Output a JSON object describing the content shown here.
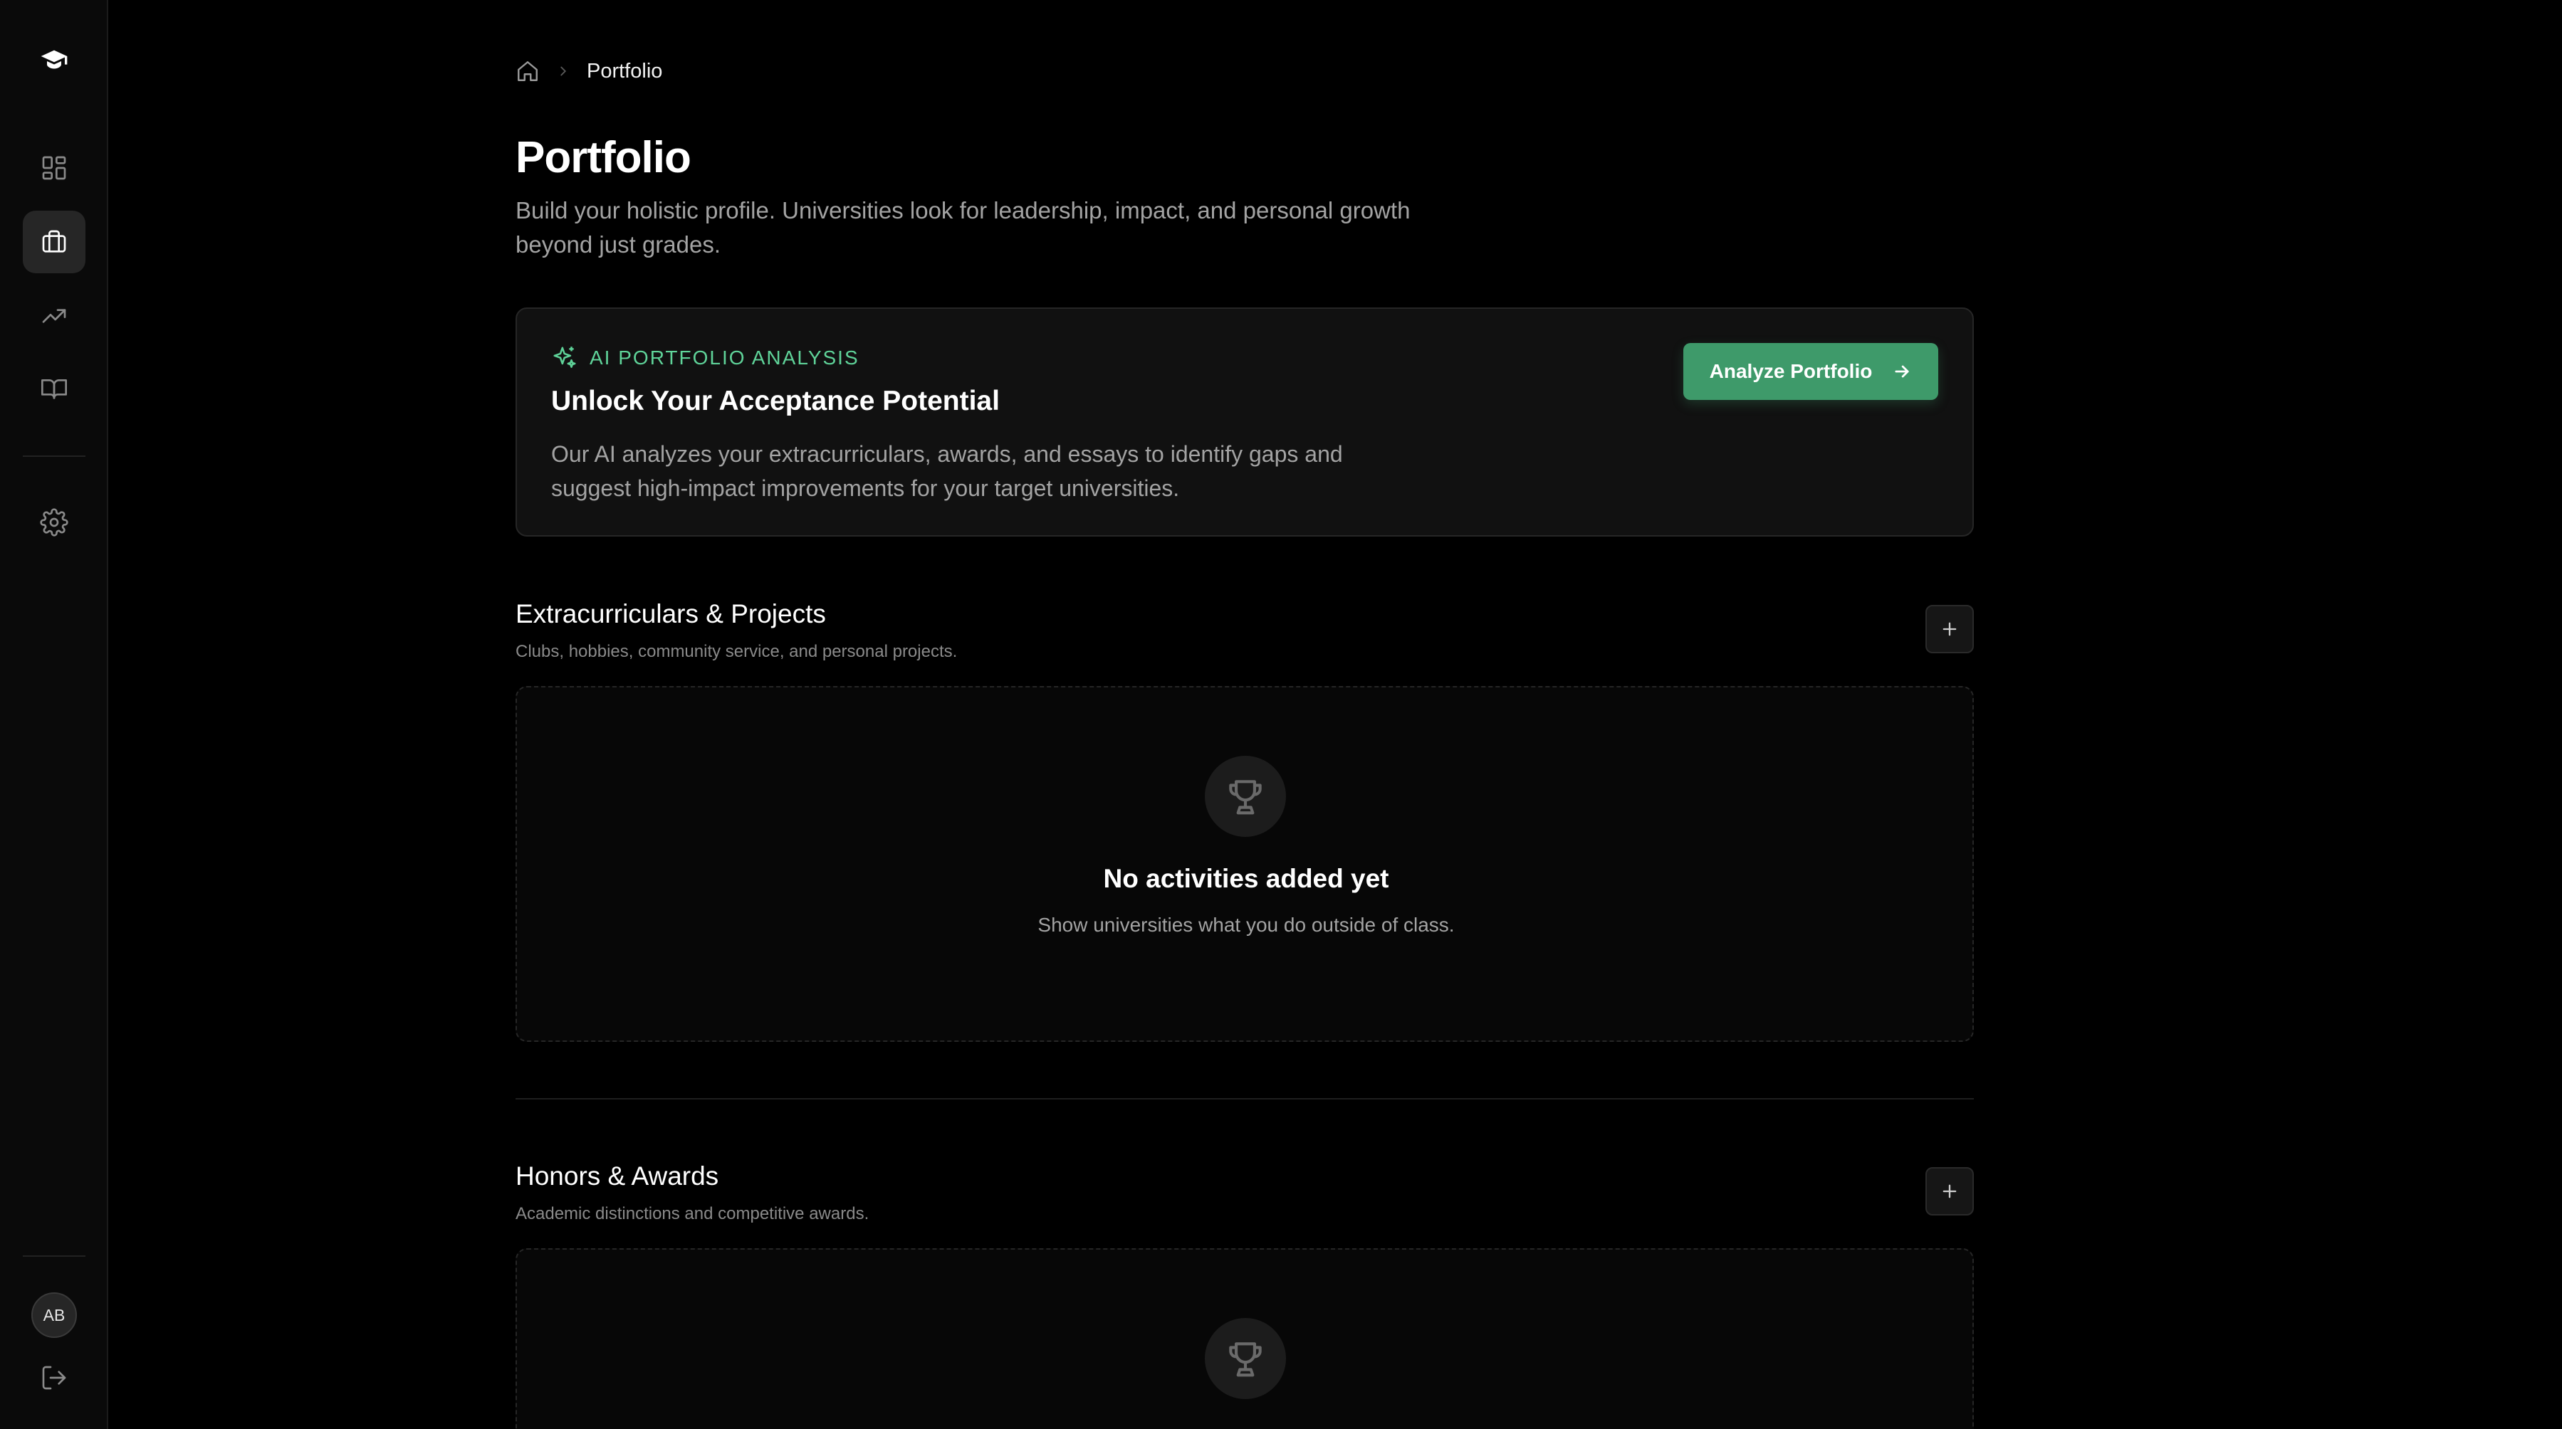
{
  "sidebar": {
    "logo_icon": "graduation-cap-icon",
    "nav": [
      {
        "icon": "dashboard-icon",
        "active": false
      },
      {
        "icon": "briefcase-icon",
        "active": true
      },
      {
        "icon": "trending-up-icon",
        "active": false
      },
      {
        "icon": "book-open-icon",
        "active": false
      }
    ],
    "settings_icon": "gear-icon",
    "avatar_initials": "AB",
    "logout_icon": "logout-icon"
  },
  "breadcrumb": {
    "home_icon": "home-icon",
    "current": "Portfolio"
  },
  "page": {
    "title": "Portfolio",
    "subtitle": "Build your holistic profile. Universities look for leadership, impact, and personal growth beyond just grades."
  },
  "ai_card": {
    "label": "AI PORTFOLIO ANALYSIS",
    "title": "Unlock Your Acceptance Potential",
    "description": "Our AI analyzes your extracurriculars, awards, and essays to identify gaps and suggest high-impact improvements for your target universities.",
    "button_label": "Analyze Portfolio",
    "accent_color": "#5fd399",
    "button_color": "#3e9a6a"
  },
  "sections": [
    {
      "title": "Extracurriculars & Projects",
      "subtitle": "Clubs, hobbies, community service, and personal projects.",
      "empty_title": "No activities added yet",
      "empty_subtitle": "Show universities what you do outside of class."
    },
    {
      "title": "Honors & Awards",
      "subtitle": "Academic distinctions and competitive awards."
    }
  ]
}
